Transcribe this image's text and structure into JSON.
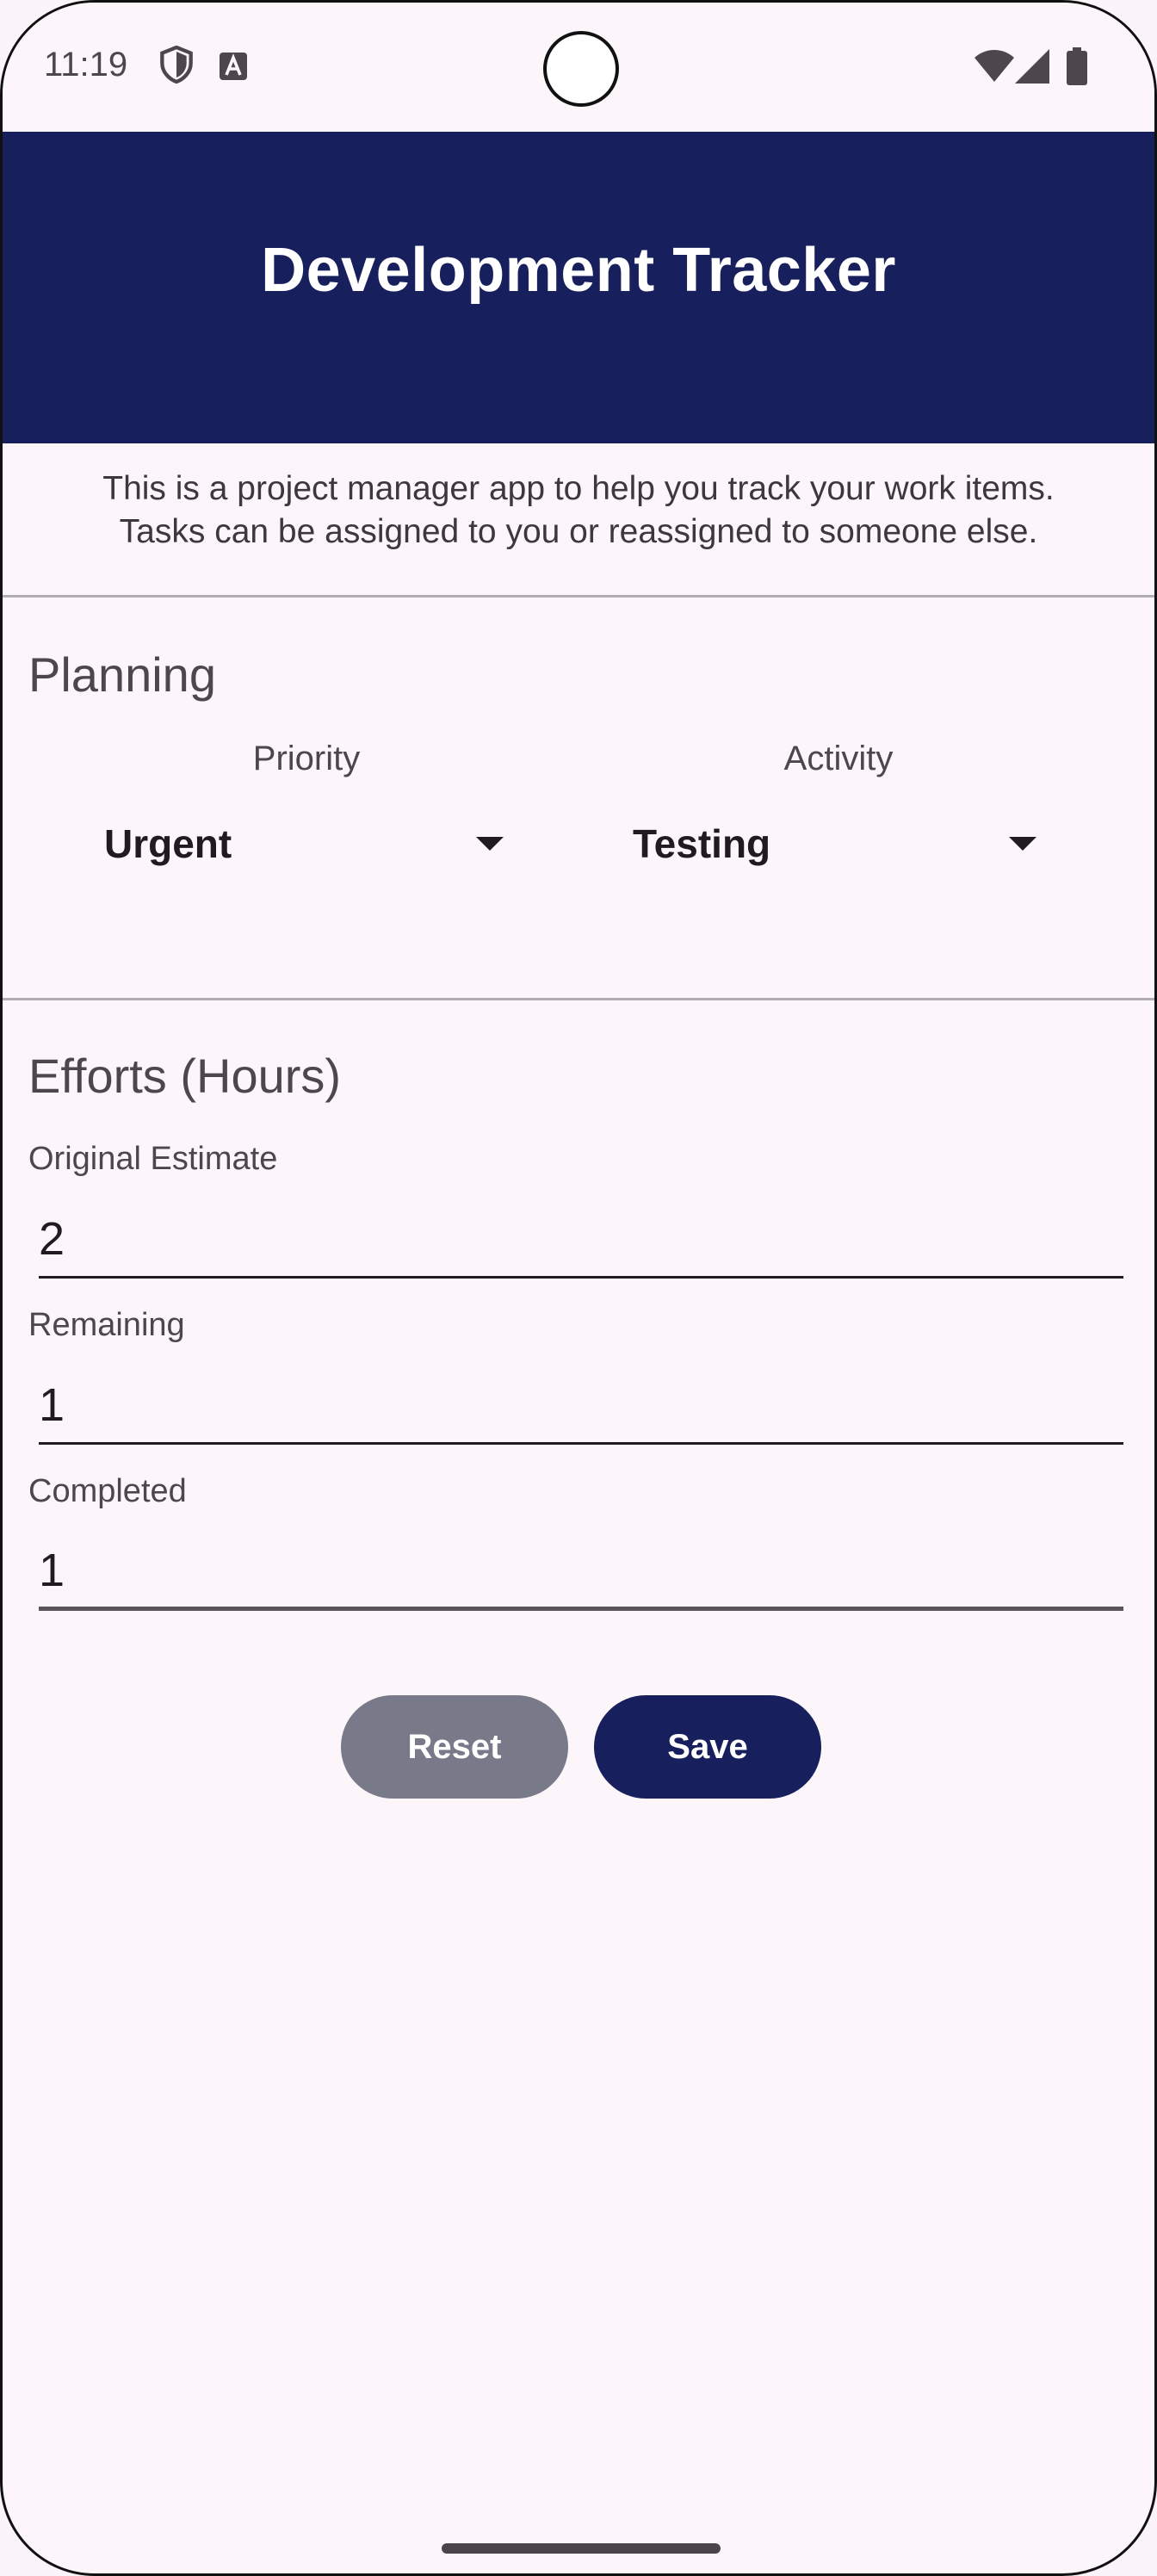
{
  "status_bar": {
    "time": "11:19",
    "icons": [
      "shield-icon",
      "font-a-icon",
      "wifi-icon",
      "cell-signal-icon",
      "battery-icon"
    ]
  },
  "header": {
    "title": "Development Tracker",
    "background_color": "#181f5d"
  },
  "description": {
    "line1": "This is a project manager app to help you track your work items.",
    "line2": "Tasks can be assigned to you or reassigned to someone else."
  },
  "planning": {
    "title": "Planning",
    "priority": {
      "label": "Priority",
      "value": "Urgent"
    },
    "activity": {
      "label": "Activity",
      "value": "Testing"
    }
  },
  "efforts": {
    "title": "Efforts (Hours)",
    "original_estimate": {
      "label": "Original Estimate",
      "value": "2"
    },
    "remaining": {
      "label": "Remaining",
      "value": "1"
    },
    "completed": {
      "label": "Completed",
      "value": "1"
    }
  },
  "buttons": {
    "reset_label": "Reset",
    "save_label": "Save",
    "reset_color": "#787a89",
    "save_color": "#181f5d"
  }
}
